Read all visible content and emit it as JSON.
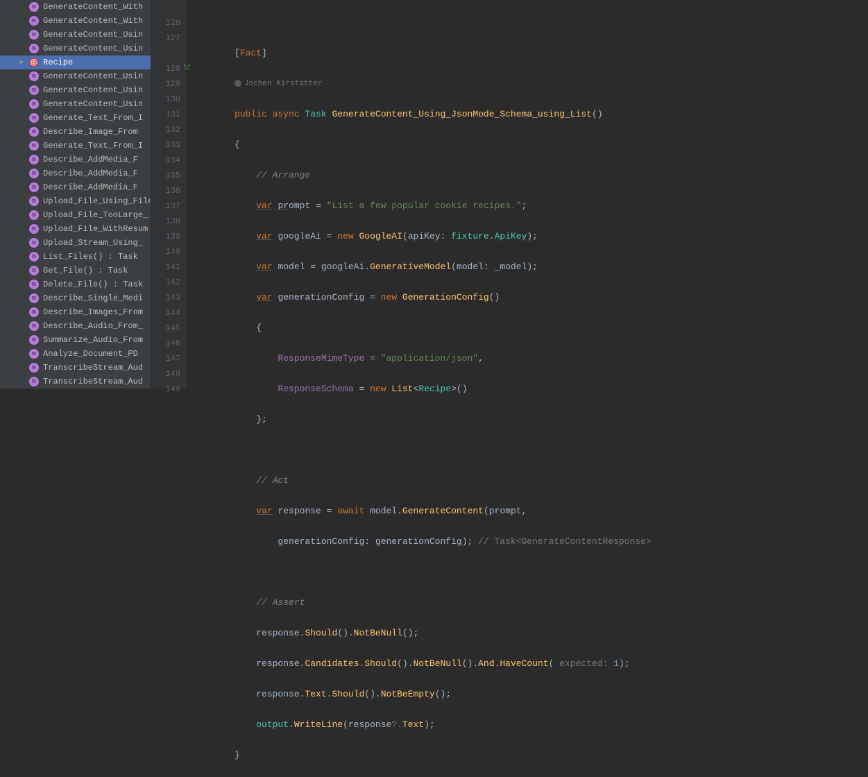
{
  "sidebar": {
    "items": [
      {
        "label": "GenerateContent_With",
        "kind": "method"
      },
      {
        "label": "GenerateContent_With",
        "kind": "method"
      },
      {
        "label": "GenerateContent_Usin",
        "kind": "method"
      },
      {
        "label": "GenerateContent_Usin",
        "kind": "method"
      },
      {
        "label": "Recipe",
        "kind": "recipe",
        "selected": true,
        "expandable": true
      },
      {
        "label": "GenerateContent_Usin",
        "kind": "method"
      },
      {
        "label": "GenerateContent_Usin",
        "kind": "method"
      },
      {
        "label": "GenerateContent_Usin",
        "kind": "method"
      },
      {
        "label": "Generate_Text_From_I",
        "kind": "method"
      },
      {
        "label": "Describe_Image_From",
        "kind": "method"
      },
      {
        "label": "Generate_Text_From_I",
        "kind": "method"
      },
      {
        "label": "Describe_AddMedia_F",
        "kind": "method"
      },
      {
        "label": "Describe_AddMedia_F",
        "kind": "method"
      },
      {
        "label": "Describe_AddMedia_F",
        "kind": "method"
      },
      {
        "label": "Upload_File_Using_File",
        "kind": "method"
      },
      {
        "label": "Upload_File_TooLarge_",
        "kind": "method"
      },
      {
        "label": "Upload_File_WithResum",
        "kind": "method"
      },
      {
        "label": "Upload_Stream_Using_",
        "kind": "method"
      },
      {
        "label": "List_Files() : Task",
        "kind": "method"
      },
      {
        "label": "Get_File() : Task",
        "kind": "method"
      },
      {
        "label": "Delete_File() : Task",
        "kind": "method"
      },
      {
        "label": "Describe_Single_Medi",
        "kind": "method"
      },
      {
        "label": "Describe_Images_From",
        "kind": "method"
      },
      {
        "label": "Describe_Audio_From_",
        "kind": "method"
      },
      {
        "label": "Summarize_Audio_From",
        "kind": "method"
      },
      {
        "label": "Analyze_Document_PD",
        "kind": "method"
      },
      {
        "label": "TranscribeStream_Aud",
        "kind": "method"
      },
      {
        "label": "TranscribeStream_Aud",
        "kind": "method"
      }
    ]
  },
  "gutter": {
    "lines": [
      "",
      "126",
      "127",
      "",
      "128",
      "129",
      "130",
      "131",
      "132",
      "133",
      "134",
      "135",
      "136",
      "137",
      "138",
      "139",
      "140",
      "141",
      "142",
      "143",
      "144",
      "145",
      "146",
      "147",
      "148",
      "149"
    ]
  },
  "author": "Jochen Kirstätter",
  "code": {
    "attr_open": "[",
    "attr_name": "Fact",
    "attr_close": "]",
    "public": "public",
    "async": "async",
    "task": "Task",
    "fn_name": "GenerateContent_Using_JsonMode_Schema_using_List",
    "brace_open": "{",
    "brace_close": "}",
    "c_arrange": "// Arrange",
    "c_act": "// Act",
    "c_assert": "// Assert",
    "var": "var",
    "prompt_id": "prompt",
    "eq": " = ",
    "prompt_str": "\"List a few popular cookie recipes.\"",
    "semi": ";",
    "googleAi": "googleAi",
    "new": "new",
    "GoogleAI": "GoogleAI",
    "apiKey": "apiKey:",
    "fixture": "fixture",
    "ApiKey": "ApiKey",
    "model": "model",
    "GenerativeModel": "GenerativeModel",
    "model_param": "model:",
    "model_val": "_model",
    "generationConfig": "generationConfig",
    "GenerationConfig": "GenerationConfig",
    "ResponseMimeType": "ResponseMimeType",
    "mime_str": "\"application/json\"",
    "ResponseSchema": "ResponseSchema",
    "List": "List",
    "Recipe": "Recipe",
    "response": "response",
    "await": "await",
    "GenerateContent": "GenerateContent",
    "gc_param": "generationConfig:",
    "hint_task": "// Task<GenerateContentResponse>",
    "Should": "Should",
    "NotBeNull": "NotBeNull",
    "Candidates": "Candidates",
    "And": "And",
    "HaveCount": "HaveCount",
    "expected_hint": "expected:",
    "one": "1",
    "Text": "Text",
    "NotBeEmpty": "NotBeEmpty",
    "output": "output",
    "WriteLine": "WriteLine",
    "qdot": "?.",
    "comma": ","
  }
}
